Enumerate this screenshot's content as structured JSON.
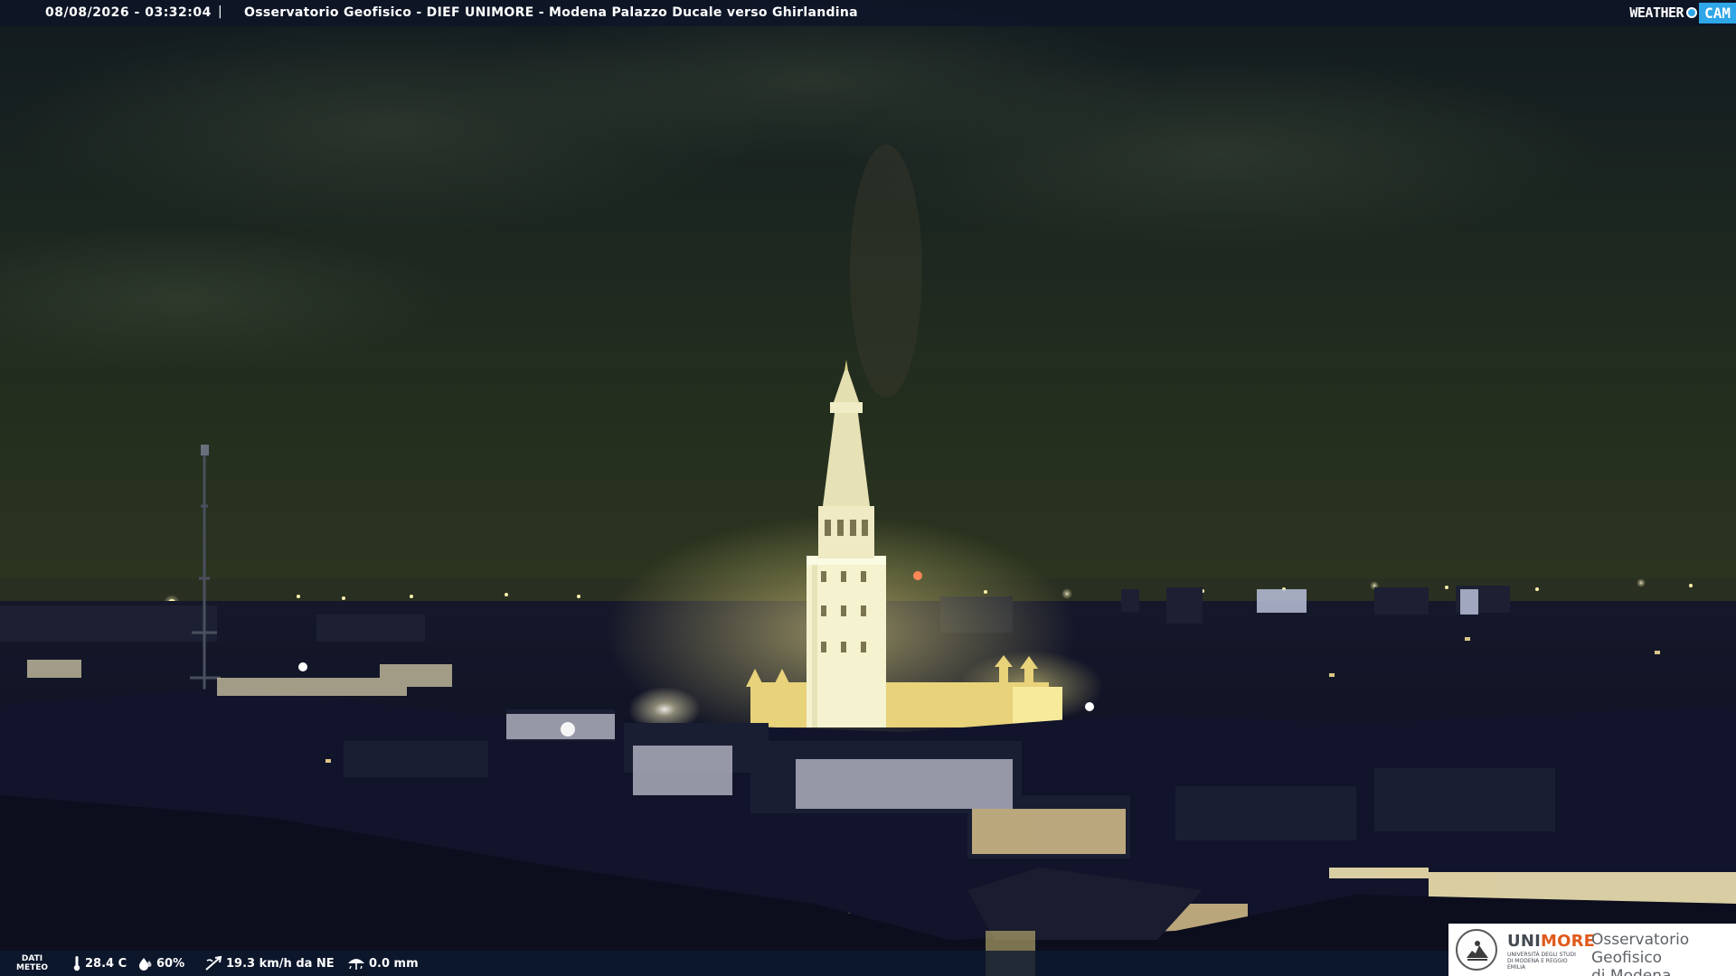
{
  "overlay": {
    "timestamp": "08/08/2026 - 03:32:04",
    "separator": "|",
    "title": "Osservatorio Geofisico - DIEF UNIMORE - Modena Palazzo Ducale verso Ghirlandina"
  },
  "brand": {
    "weather": "WEATHER",
    "cam": "CAM"
  },
  "weather": {
    "dati_line1": "DATI",
    "dati_line2": "METEO",
    "temperature": "28.4 C",
    "humidity": "60%",
    "wind": "19.3 km/h da NE",
    "rain": "0.0 mm"
  },
  "logo": {
    "unimore_part1": "UNI",
    "unimore_part2": "MORE",
    "unimore_sub": "UNIVERSITÀ DEGLI STUDI DI MODENA E REGGIO EMILIA",
    "osservatorio_line1": "Osservatorio Geofisico",
    "osservatorio_line2": "di Modena"
  },
  "colors": {
    "sky": "#1f2a1e",
    "tower": "#f3f1cc",
    "glow": "#f5e27a",
    "unimore_accent": "#e05a1c",
    "weathercam_blue": "#2ea6e8"
  },
  "icons": [
    "thermometer-icon",
    "humidity-icon",
    "wind-icon",
    "rain-gauge-icon",
    "weathercam-dot-icon",
    "unimore-seal-icon"
  ]
}
